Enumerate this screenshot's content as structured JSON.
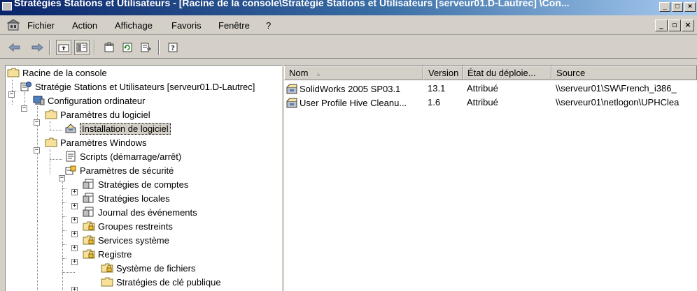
{
  "window": {
    "title": "Stratégies Stations et Utilisateurs - [Racine de la console\\Stratégie Stations et Utilisateurs [serveur01.D-Lautrec] \\Con...",
    "controls": [
      "_",
      "□",
      "×"
    ]
  },
  "menubar": {
    "items": [
      "Fichier",
      "Action",
      "Affichage",
      "Favoris",
      "Fenêtre",
      "?"
    ],
    "mdi_controls": [
      "_",
      "▫",
      "×"
    ]
  },
  "toolbar": {
    "buttons": [
      "back-icon",
      "forward-icon",
      "up-folder-icon",
      "show-hide-tree-icon",
      "properties-icon",
      "refresh-icon",
      "export-list-icon",
      "help-icon"
    ]
  },
  "tree": {
    "nodes": [
      {
        "label": "Racine de la console",
        "icon": "folder-icon"
      },
      {
        "label": "Stratégie Stations et Utilisateurs [serveur01.D-Lautrec]",
        "icon": "gpo-icon"
      },
      {
        "label": "Configuration ordinateur",
        "icon": "computer-icon"
      },
      {
        "label": "Paramètres du logiciel",
        "icon": "folder-icon"
      },
      {
        "label": "Installation de logiciel",
        "icon": "software-install-icon"
      },
      {
        "label": "Paramètres Windows",
        "icon": "folder-icon"
      },
      {
        "label": "Scripts (démarrage/arrêt)",
        "icon": "script-icon"
      },
      {
        "label": "Paramètres de sécurité",
        "icon": "security-icon"
      },
      {
        "label": "Stratégies de comptes",
        "icon": "policy-icon"
      },
      {
        "label": "Stratégies locales",
        "icon": "policy-icon"
      },
      {
        "label": "Journal des événements",
        "icon": "policy-icon"
      },
      {
        "label": "Groupes restreints",
        "icon": "lock-folder-icon"
      },
      {
        "label": "Services système",
        "icon": "lock-folder-icon"
      },
      {
        "label": "Registre",
        "icon": "lock-folder-icon"
      },
      {
        "label": "Système de fichiers",
        "icon": "lock-folder-icon"
      },
      {
        "label": "Stratégies de clé publique",
        "icon": "folder-icon"
      }
    ]
  },
  "list": {
    "columns": [
      "Nom",
      "Version",
      "État du déploie...",
      "Source"
    ],
    "rows": [
      {
        "name": "SolidWorks 2005 SP03.1",
        "version": "13.1",
        "state": "Attribué",
        "source": "\\\\serveur01\\SW\\French_i386_"
      },
      {
        "name": "User Profile Hive Cleanu...",
        "version": "1.6",
        "state": "Attribué",
        "source": "\\\\serveur01\\netlogon\\UPHClea"
      }
    ]
  }
}
